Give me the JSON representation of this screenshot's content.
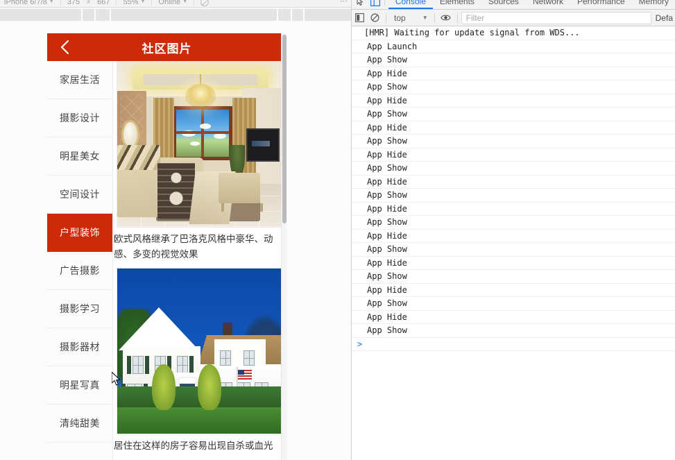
{
  "device_toolbar": {
    "device_name": "iPhone 6/7/8",
    "width": "375",
    "x_label": "x",
    "height": "667",
    "zoom": "55%",
    "throttling": "Online",
    "rotate_icon": "rotate-icon",
    "more_icon": "more-options-icon"
  },
  "app": {
    "header": {
      "back_icon": "back-chevron-icon",
      "title": "社区图片"
    },
    "categories": [
      {
        "label": "家居生活",
        "active": false
      },
      {
        "label": "摄影设计",
        "active": false
      },
      {
        "label": "明星美女",
        "active": false
      },
      {
        "label": "空间设计",
        "active": false
      },
      {
        "label": "户型装饰",
        "active": true
      },
      {
        "label": "广告摄影",
        "active": false
      },
      {
        "label": "摄影学习",
        "active": false
      },
      {
        "label": "摄影器材",
        "active": false
      },
      {
        "label": "明星写真",
        "active": false
      },
      {
        "label": "清纯甜美",
        "active": false
      }
    ],
    "cards": [
      {
        "image_name": "european-style-bedroom-photo",
        "caption": "欧式风格继承了巴洛克风格中豪华、动感、多变的视觉效果"
      },
      {
        "image_name": "white-suburban-house-photo",
        "caption": "居住在这样的房子容易出现自杀或血光"
      }
    ]
  },
  "devtools": {
    "inspect_icon": "inspect-element-icon",
    "device_toggle_icon": "device-toolbar-icon",
    "tabs": [
      {
        "label": "Console",
        "active": true
      },
      {
        "label": "Elements",
        "active": false
      },
      {
        "label": "Sources",
        "active": false
      },
      {
        "label": "Network",
        "active": false
      },
      {
        "label": "Performance",
        "active": false
      },
      {
        "label": "Memory",
        "active": false
      }
    ],
    "filter_bar": {
      "sidebar_icon": "console-sidebar-icon",
      "clear_icon": "clear-console-icon",
      "context": "top",
      "context_caret": "chevron-down-icon",
      "eye_icon": "live-expression-icon",
      "filter_placeholder": "Filter",
      "levels": "Defa"
    },
    "console_logs": [
      "[HMR] Waiting for update signal from WDS...",
      "App Launch",
      "App Show",
      "App Hide",
      "App Show",
      "App Hide",
      "App Show",
      "App Hide",
      "App Show",
      "App Hide",
      "App Show",
      "App Hide",
      "App Show",
      "App Hide",
      "App Show",
      "App Hide",
      "App Show",
      "App Hide",
      "App Show",
      "App Hide",
      "App Show",
      "App Hide",
      "App Show"
    ],
    "prompt_symbol": ">"
  },
  "colors": {
    "app_accent": "#cc2a09",
    "devtools_active_tab": "#1a73e8",
    "prompt": "#1a73e8"
  }
}
